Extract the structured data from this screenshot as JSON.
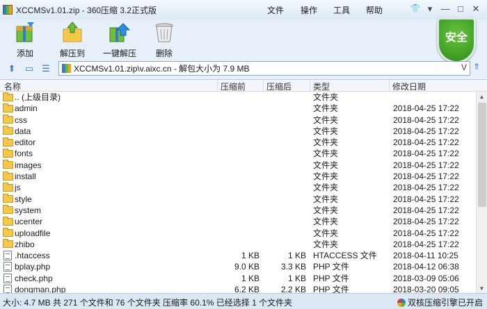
{
  "window": {
    "title": "XCCMSv1.01.zip - 360压缩 3.2正式版"
  },
  "menu": [
    "文件",
    "操作",
    "工具",
    "帮助"
  ],
  "toolbar": {
    "add": "添加",
    "extract_to": "解压到",
    "one_click": "一键解压",
    "delete": "删除",
    "security_badge": "安全"
  },
  "address": {
    "path": "XCCMSv1.01.zip\\v.aixc.cn - 解包大小为 7.9 MB",
    "dropdown": "V"
  },
  "columns": {
    "name": "名称",
    "orig_size": "压缩前",
    "comp_size": "压缩后",
    "type": "类型",
    "modified": "修改日期"
  },
  "rows": [
    {
      "name": ".. (上级目录)",
      "orig": "",
      "comp": "",
      "type": "文件夹",
      "date": "",
      "kind": "folder"
    },
    {
      "name": "admin",
      "orig": "",
      "comp": "",
      "type": "文件夹",
      "date": "2018-04-25 17:22",
      "kind": "folder"
    },
    {
      "name": "css",
      "orig": "",
      "comp": "",
      "type": "文件夹",
      "date": "2018-04-25 17:22",
      "kind": "folder"
    },
    {
      "name": "data",
      "orig": "",
      "comp": "",
      "type": "文件夹",
      "date": "2018-04-25 17:22",
      "kind": "folder"
    },
    {
      "name": "editor",
      "orig": "",
      "comp": "",
      "type": "文件夹",
      "date": "2018-04-25 17:22",
      "kind": "folder"
    },
    {
      "name": "fonts",
      "orig": "",
      "comp": "",
      "type": "文件夹",
      "date": "2018-04-25 17:22",
      "kind": "folder"
    },
    {
      "name": "images",
      "orig": "",
      "comp": "",
      "type": "文件夹",
      "date": "2018-04-25 17:22",
      "kind": "folder"
    },
    {
      "name": "install",
      "orig": "",
      "comp": "",
      "type": "文件夹",
      "date": "2018-04-25 17:22",
      "kind": "folder"
    },
    {
      "name": "js",
      "orig": "",
      "comp": "",
      "type": "文件夹",
      "date": "2018-04-25 17:22",
      "kind": "folder"
    },
    {
      "name": "style",
      "orig": "",
      "comp": "",
      "type": "文件夹",
      "date": "2018-04-25 17:22",
      "kind": "folder"
    },
    {
      "name": "system",
      "orig": "",
      "comp": "",
      "type": "文件夹",
      "date": "2018-04-25 17:22",
      "kind": "folder"
    },
    {
      "name": "ucenter",
      "orig": "",
      "comp": "",
      "type": "文件夹",
      "date": "2018-04-25 17:22",
      "kind": "folder"
    },
    {
      "name": "uploadfile",
      "orig": "",
      "comp": "",
      "type": "文件夹",
      "date": "2018-04-25 17:22",
      "kind": "folder"
    },
    {
      "name": "zhibo",
      "orig": "",
      "comp": "",
      "type": "文件夹",
      "date": "2018-04-25 17:22",
      "kind": "folder"
    },
    {
      "name": ".htaccess",
      "orig": "1 KB",
      "comp": "1 KB",
      "type": "HTACCESS 文件",
      "date": "2018-04-11 10:25",
      "kind": "file"
    },
    {
      "name": "bplay.php",
      "orig": "9.0 KB",
      "comp": "3.3 KB",
      "type": "PHP 文件",
      "date": "2018-04-12 06:38",
      "kind": "file"
    },
    {
      "name": "check.php",
      "orig": "1 KB",
      "comp": "1 KB",
      "type": "PHP 文件",
      "date": "2018-03-09 05:06",
      "kind": "file"
    },
    {
      "name": "dongman.php",
      "orig": "6.2 KB",
      "comp": "2.2 KB",
      "type": "PHP 文件",
      "date": "2018-03-20 09:05",
      "kind": "file"
    }
  ],
  "status": {
    "summary": "大小: 4.7 MB 共 271 个文件和 76 个文件夹 压缩率 60.1% 已经选择 1 个文件夹",
    "engine": "双核压缩引擎已开启"
  }
}
